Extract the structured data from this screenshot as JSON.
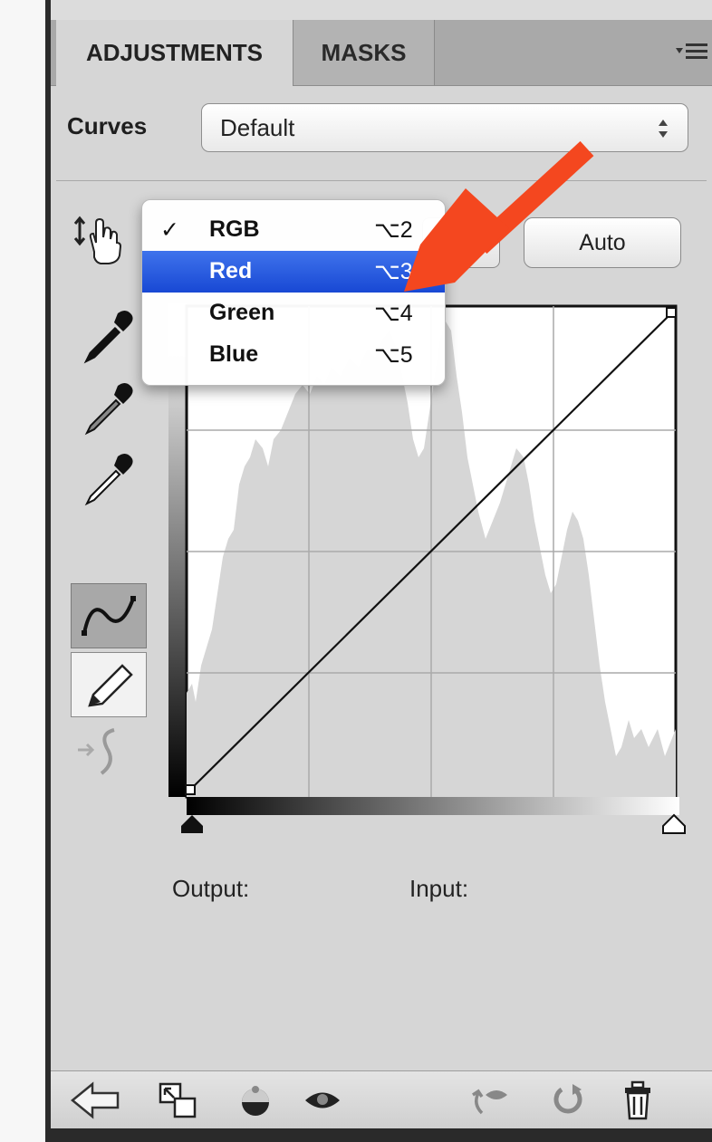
{
  "tabs": [
    {
      "label": "ADJUSTMENTS",
      "active": true
    },
    {
      "label": "MASKS",
      "active": false
    }
  ],
  "curves": {
    "label": "Curves",
    "preset_value": "Default"
  },
  "auto_button": "Auto",
  "channel_menu": {
    "items": [
      {
        "check": "✓",
        "label": "RGB",
        "shortcut": "⌥2"
      },
      {
        "check": "",
        "label": "Red",
        "shortcut": "⌥3"
      },
      {
        "check": "",
        "label": "Green",
        "shortcut": "⌥4"
      },
      {
        "check": "",
        "label": "Blue",
        "shortcut": "⌥5"
      }
    ],
    "selected_label": "Red"
  },
  "readouts": {
    "output_label": "Output:",
    "input_label": "Input:"
  },
  "colors": {
    "menu_highlight": "#2a5de0",
    "annotation_arrow": "#f4471f",
    "panel_bg": "#d6d6d6"
  },
  "icons": [
    "target-adjust-hand-icon",
    "black-eyedropper-icon",
    "gray-eyedropper-icon",
    "white-eyedropper-icon",
    "curve-mode-icon",
    "pencil-mode-icon",
    "smooth-curve-icon",
    "back-arrow-icon",
    "clip-to-layer-icon",
    "visibility-toggle-icon",
    "eye-icon",
    "previous-state-icon",
    "reset-icon",
    "trash-icon",
    "panel-menu-icon"
  ]
}
